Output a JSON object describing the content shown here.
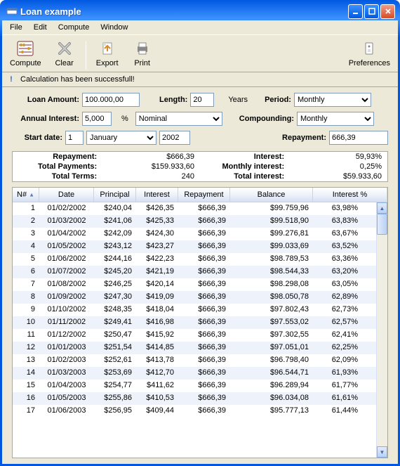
{
  "window": {
    "title": "Loan example"
  },
  "menu": {
    "file": "File",
    "edit": "Edit",
    "compute": "Compute",
    "window": "Window"
  },
  "toolbar": {
    "compute": "Compute",
    "clear": "Clear",
    "export": "Export",
    "print": "Print",
    "prefs": "Preferences"
  },
  "status": {
    "message": "Calculation has been successfull!"
  },
  "inputs": {
    "loan_amount_label": "Loan Amount:",
    "loan_amount": "100.000,00",
    "length_label": "Length:",
    "length": "20",
    "years_label": "Years",
    "period_label": "Period:",
    "period": "Monthly",
    "annual_interest_label": "Annual Interest:",
    "annual_interest": "5,000",
    "percent_label": "%",
    "interest_type": "Nominal",
    "compounding_label": "Compounding:",
    "compounding": "Monthly",
    "start_date_label": "Start date:",
    "start_day": "1",
    "start_month": "January",
    "start_year": "2002",
    "repayment_label": "Repayment:",
    "repayment": "666,39"
  },
  "summary": {
    "repayment_lbl": "Repayment:",
    "repayment": "$666,39",
    "interest_lbl": "Interest:",
    "interest": "59,93%",
    "total_payments_lbl": "Total Payments:",
    "total_payments": "$159.933,60",
    "monthly_interest_lbl": "Monthly interest:",
    "monthly_interest": "0,25%",
    "total_terms_lbl": "Total Terms:",
    "total_terms": "240",
    "total_interest_lbl": "Total interest:",
    "total_interest": "$59.933,60"
  },
  "grid": {
    "headers": [
      "N#",
      "Date",
      "Principal",
      "Interest",
      "Repayment",
      "Balance",
      "Interest %"
    ],
    "rows": [
      {
        "n": "1",
        "date": "01/02/2002",
        "pr": "$240,04",
        "in": "$426,35",
        "rp": "$666,39",
        "bal": "$99.759,96",
        "ip": "63,98%"
      },
      {
        "n": "2",
        "date": "01/03/2002",
        "pr": "$241,06",
        "in": "$425,33",
        "rp": "$666,39",
        "bal": "$99.518,90",
        "ip": "63,83%"
      },
      {
        "n": "3",
        "date": "01/04/2002",
        "pr": "$242,09",
        "in": "$424,30",
        "rp": "$666,39",
        "bal": "$99.276,81",
        "ip": "63,67%"
      },
      {
        "n": "4",
        "date": "01/05/2002",
        "pr": "$243,12",
        "in": "$423,27",
        "rp": "$666,39",
        "bal": "$99.033,69",
        "ip": "63,52%"
      },
      {
        "n": "5",
        "date": "01/06/2002",
        "pr": "$244,16",
        "in": "$422,23",
        "rp": "$666,39",
        "bal": "$98.789,53",
        "ip": "63,36%"
      },
      {
        "n": "6",
        "date": "01/07/2002",
        "pr": "$245,20",
        "in": "$421,19",
        "rp": "$666,39",
        "bal": "$98.544,33",
        "ip": "63,20%"
      },
      {
        "n": "7",
        "date": "01/08/2002",
        "pr": "$246,25",
        "in": "$420,14",
        "rp": "$666,39",
        "bal": "$98.298,08",
        "ip": "63,05%"
      },
      {
        "n": "8",
        "date": "01/09/2002",
        "pr": "$247,30",
        "in": "$419,09",
        "rp": "$666,39",
        "bal": "$98.050,78",
        "ip": "62,89%"
      },
      {
        "n": "9",
        "date": "01/10/2002",
        "pr": "$248,35",
        "in": "$418,04",
        "rp": "$666,39",
        "bal": "$97.802,43",
        "ip": "62,73%"
      },
      {
        "n": "10",
        "date": "01/11/2002",
        "pr": "$249,41",
        "in": "$416,98",
        "rp": "$666,39",
        "bal": "$97.553,02",
        "ip": "62,57%"
      },
      {
        "n": "11",
        "date": "01/12/2002",
        "pr": "$250,47",
        "in": "$415,92",
        "rp": "$666,39",
        "bal": "$97.302,55",
        "ip": "62,41%"
      },
      {
        "n": "12",
        "date": "01/01/2003",
        "pr": "$251,54",
        "in": "$414,85",
        "rp": "$666,39",
        "bal": "$97.051,01",
        "ip": "62,25%"
      },
      {
        "n": "13",
        "date": "01/02/2003",
        "pr": "$252,61",
        "in": "$413,78",
        "rp": "$666,39",
        "bal": "$96.798,40",
        "ip": "62,09%"
      },
      {
        "n": "14",
        "date": "01/03/2003",
        "pr": "$253,69",
        "in": "$412,70",
        "rp": "$666,39",
        "bal": "$96.544,71",
        "ip": "61,93%"
      },
      {
        "n": "15",
        "date": "01/04/2003",
        "pr": "$254,77",
        "in": "$411,62",
        "rp": "$666,39",
        "bal": "$96.289,94",
        "ip": "61,77%"
      },
      {
        "n": "16",
        "date": "01/05/2003",
        "pr": "$255,86",
        "in": "$410,53",
        "rp": "$666,39",
        "bal": "$96.034,08",
        "ip": "61,61%"
      },
      {
        "n": "17",
        "date": "01/06/2003",
        "pr": "$256,95",
        "in": "$409,44",
        "rp": "$666,39",
        "bal": "$95.777,13",
        "ip": "61,44%"
      }
    ]
  }
}
